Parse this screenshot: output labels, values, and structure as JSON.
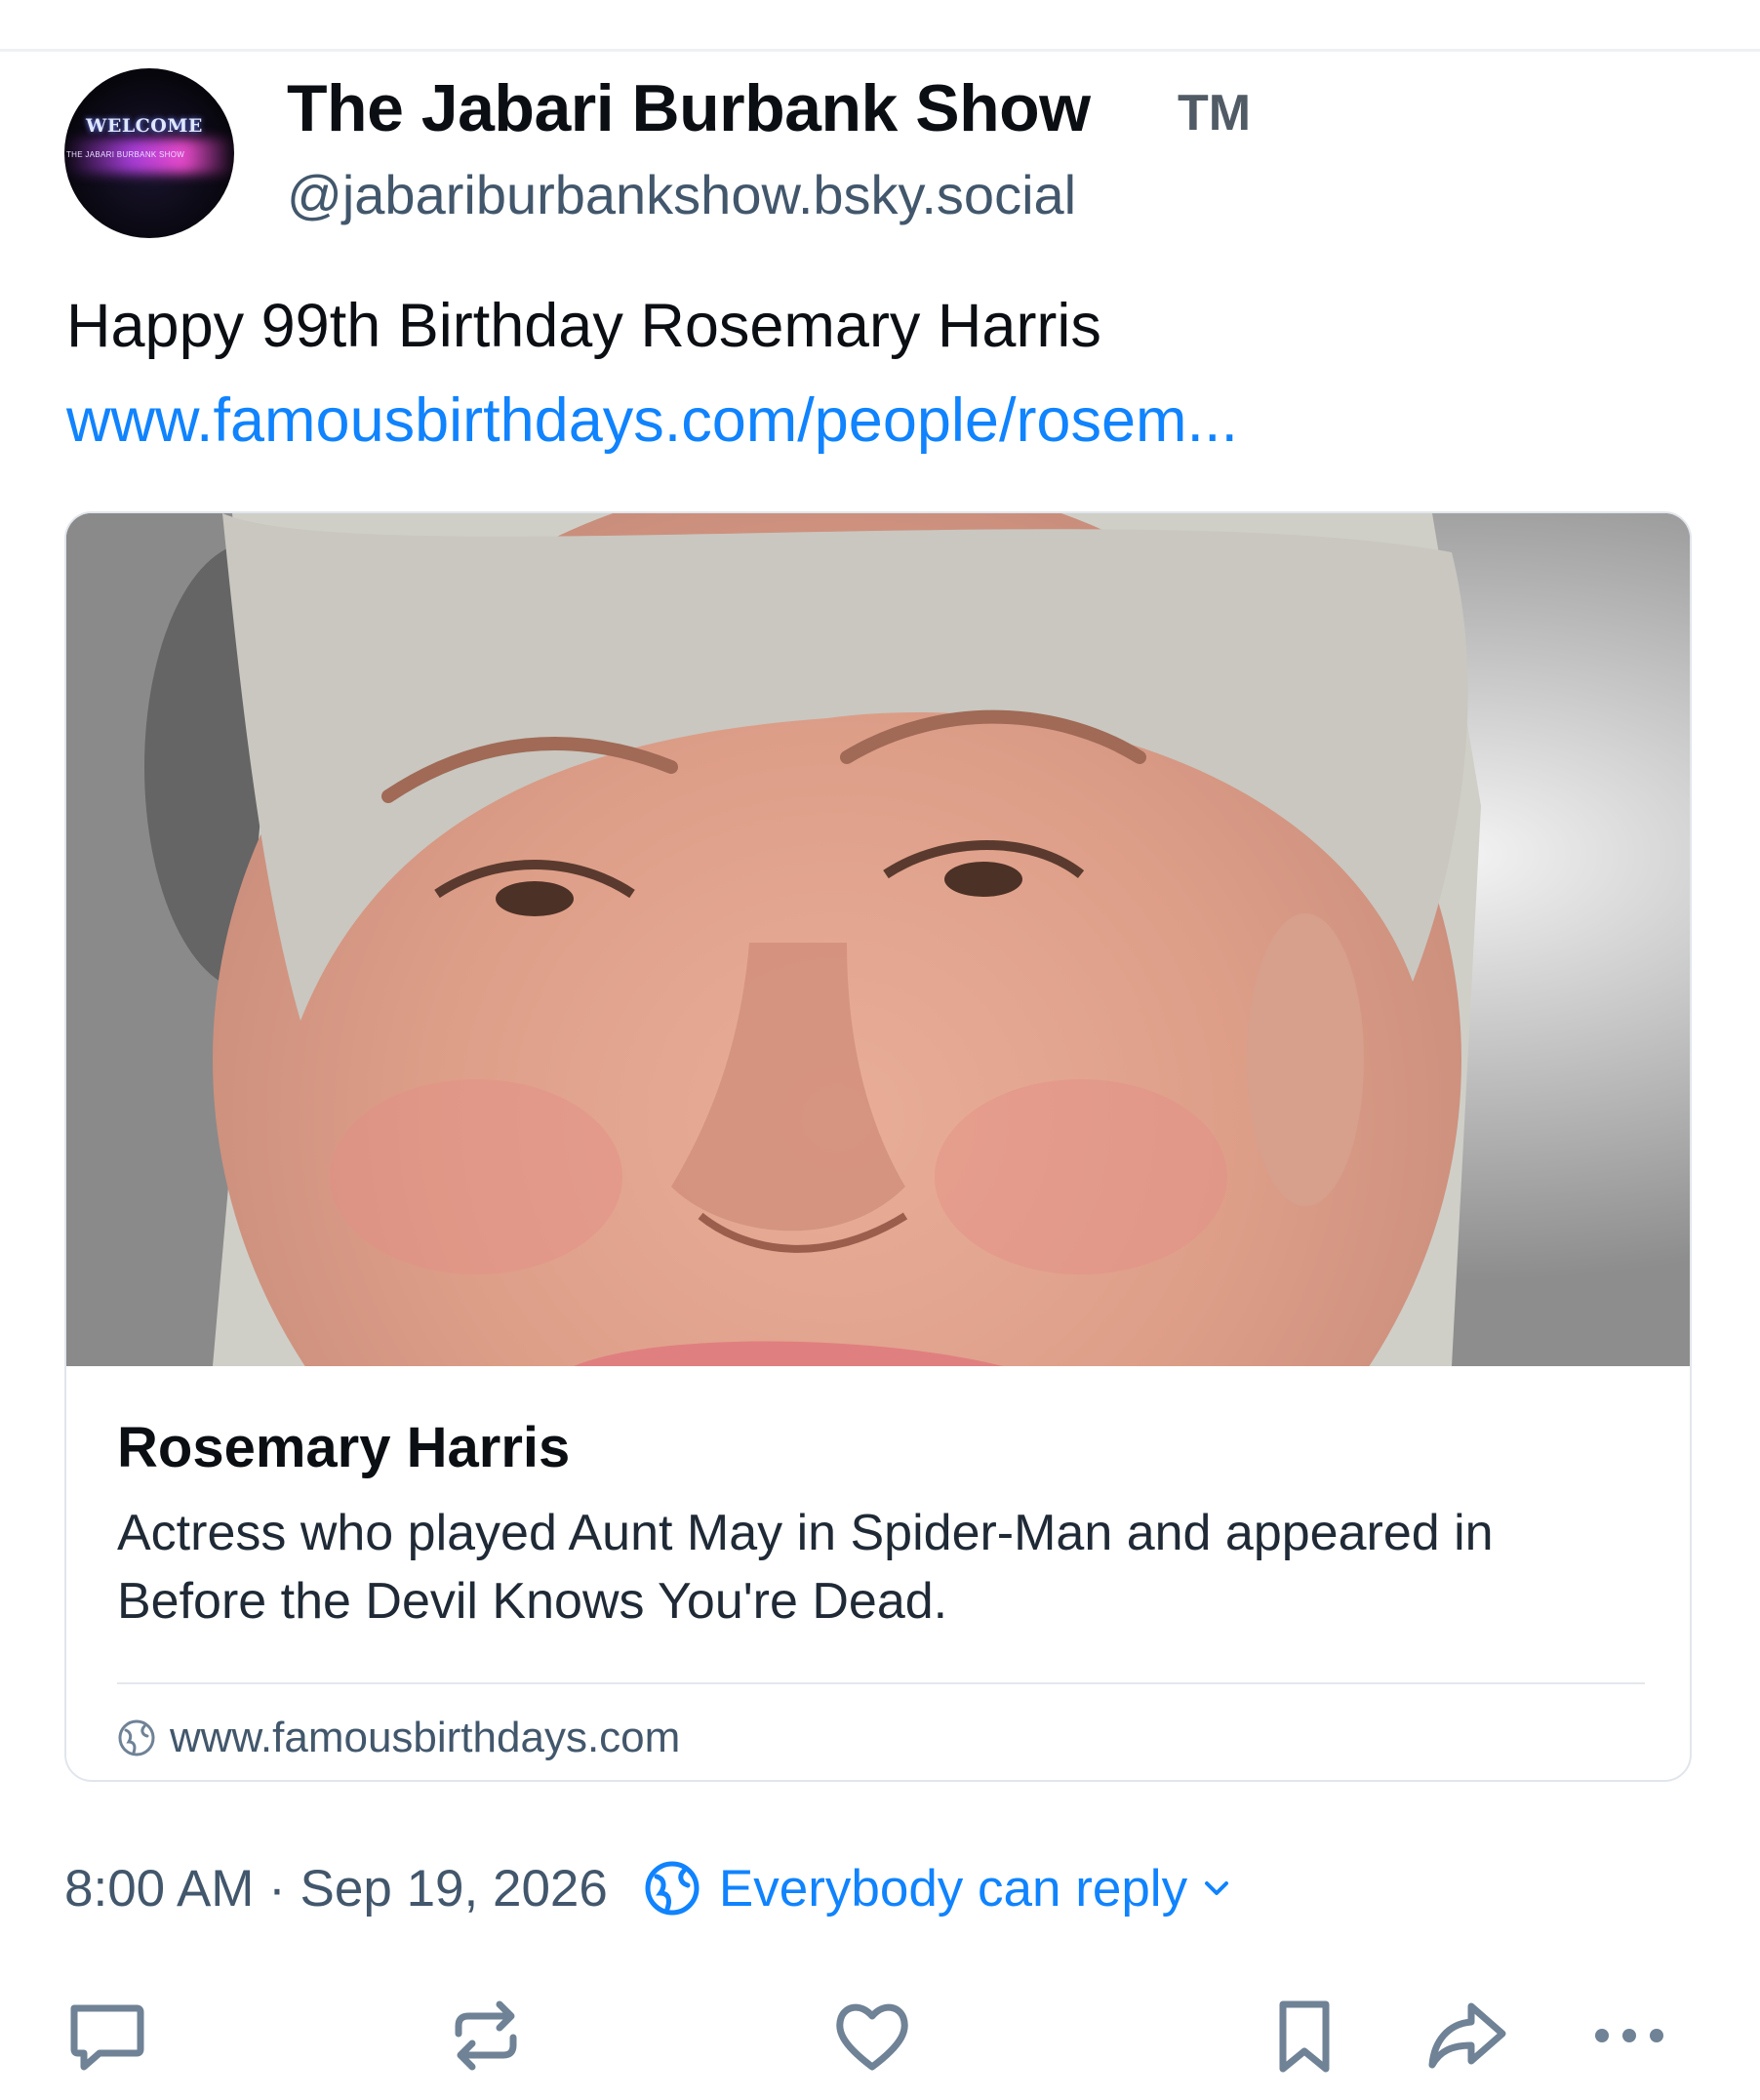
{
  "post": {
    "author": {
      "display_name": "The Jabari Burbank Show",
      "badge": "TM",
      "handle": "@jabariburbankshow.bsky.social",
      "avatar": {
        "welcome_text": "WELCOME",
        "show_text": "THE JABARI BURBANK SHOW",
        "icon": "avatar"
      }
    },
    "text": "Happy 99th Birthday Rosemary Harris",
    "link_text": "www.famousbirthdays.com/people/rosem...",
    "embed": {
      "title": "Rosemary Harris",
      "description": "Actress who played Aunt May in Spider-Man and appeared in Before the Devil Knows You're Dead.",
      "domain": "www.famousbirthdays.com",
      "domain_icon": "globe-icon"
    },
    "timestamp": "8:00 AM · Sep 19, 2026",
    "reply_setting": {
      "label": "Everybody can reply",
      "icon": "globe-icon",
      "chevron": "chevron-down-icon"
    },
    "actions": [
      {
        "name": "reply-button",
        "icon": "speech-bubble-icon"
      },
      {
        "name": "repost-button",
        "icon": "repost-icon"
      },
      {
        "name": "like-button",
        "icon": "heart-icon"
      },
      {
        "name": "bookmark-button",
        "icon": "bookmark-icon"
      },
      {
        "name": "share-button",
        "icon": "share-arrow-icon"
      },
      {
        "name": "more-button",
        "icon": "ellipsis-icon"
      }
    ]
  },
  "colors": {
    "link": "#1083fe",
    "text_primary": "#0b0f14",
    "text_secondary": "#42576c",
    "border": "#e1e6ec",
    "icon": "#6f8296"
  }
}
